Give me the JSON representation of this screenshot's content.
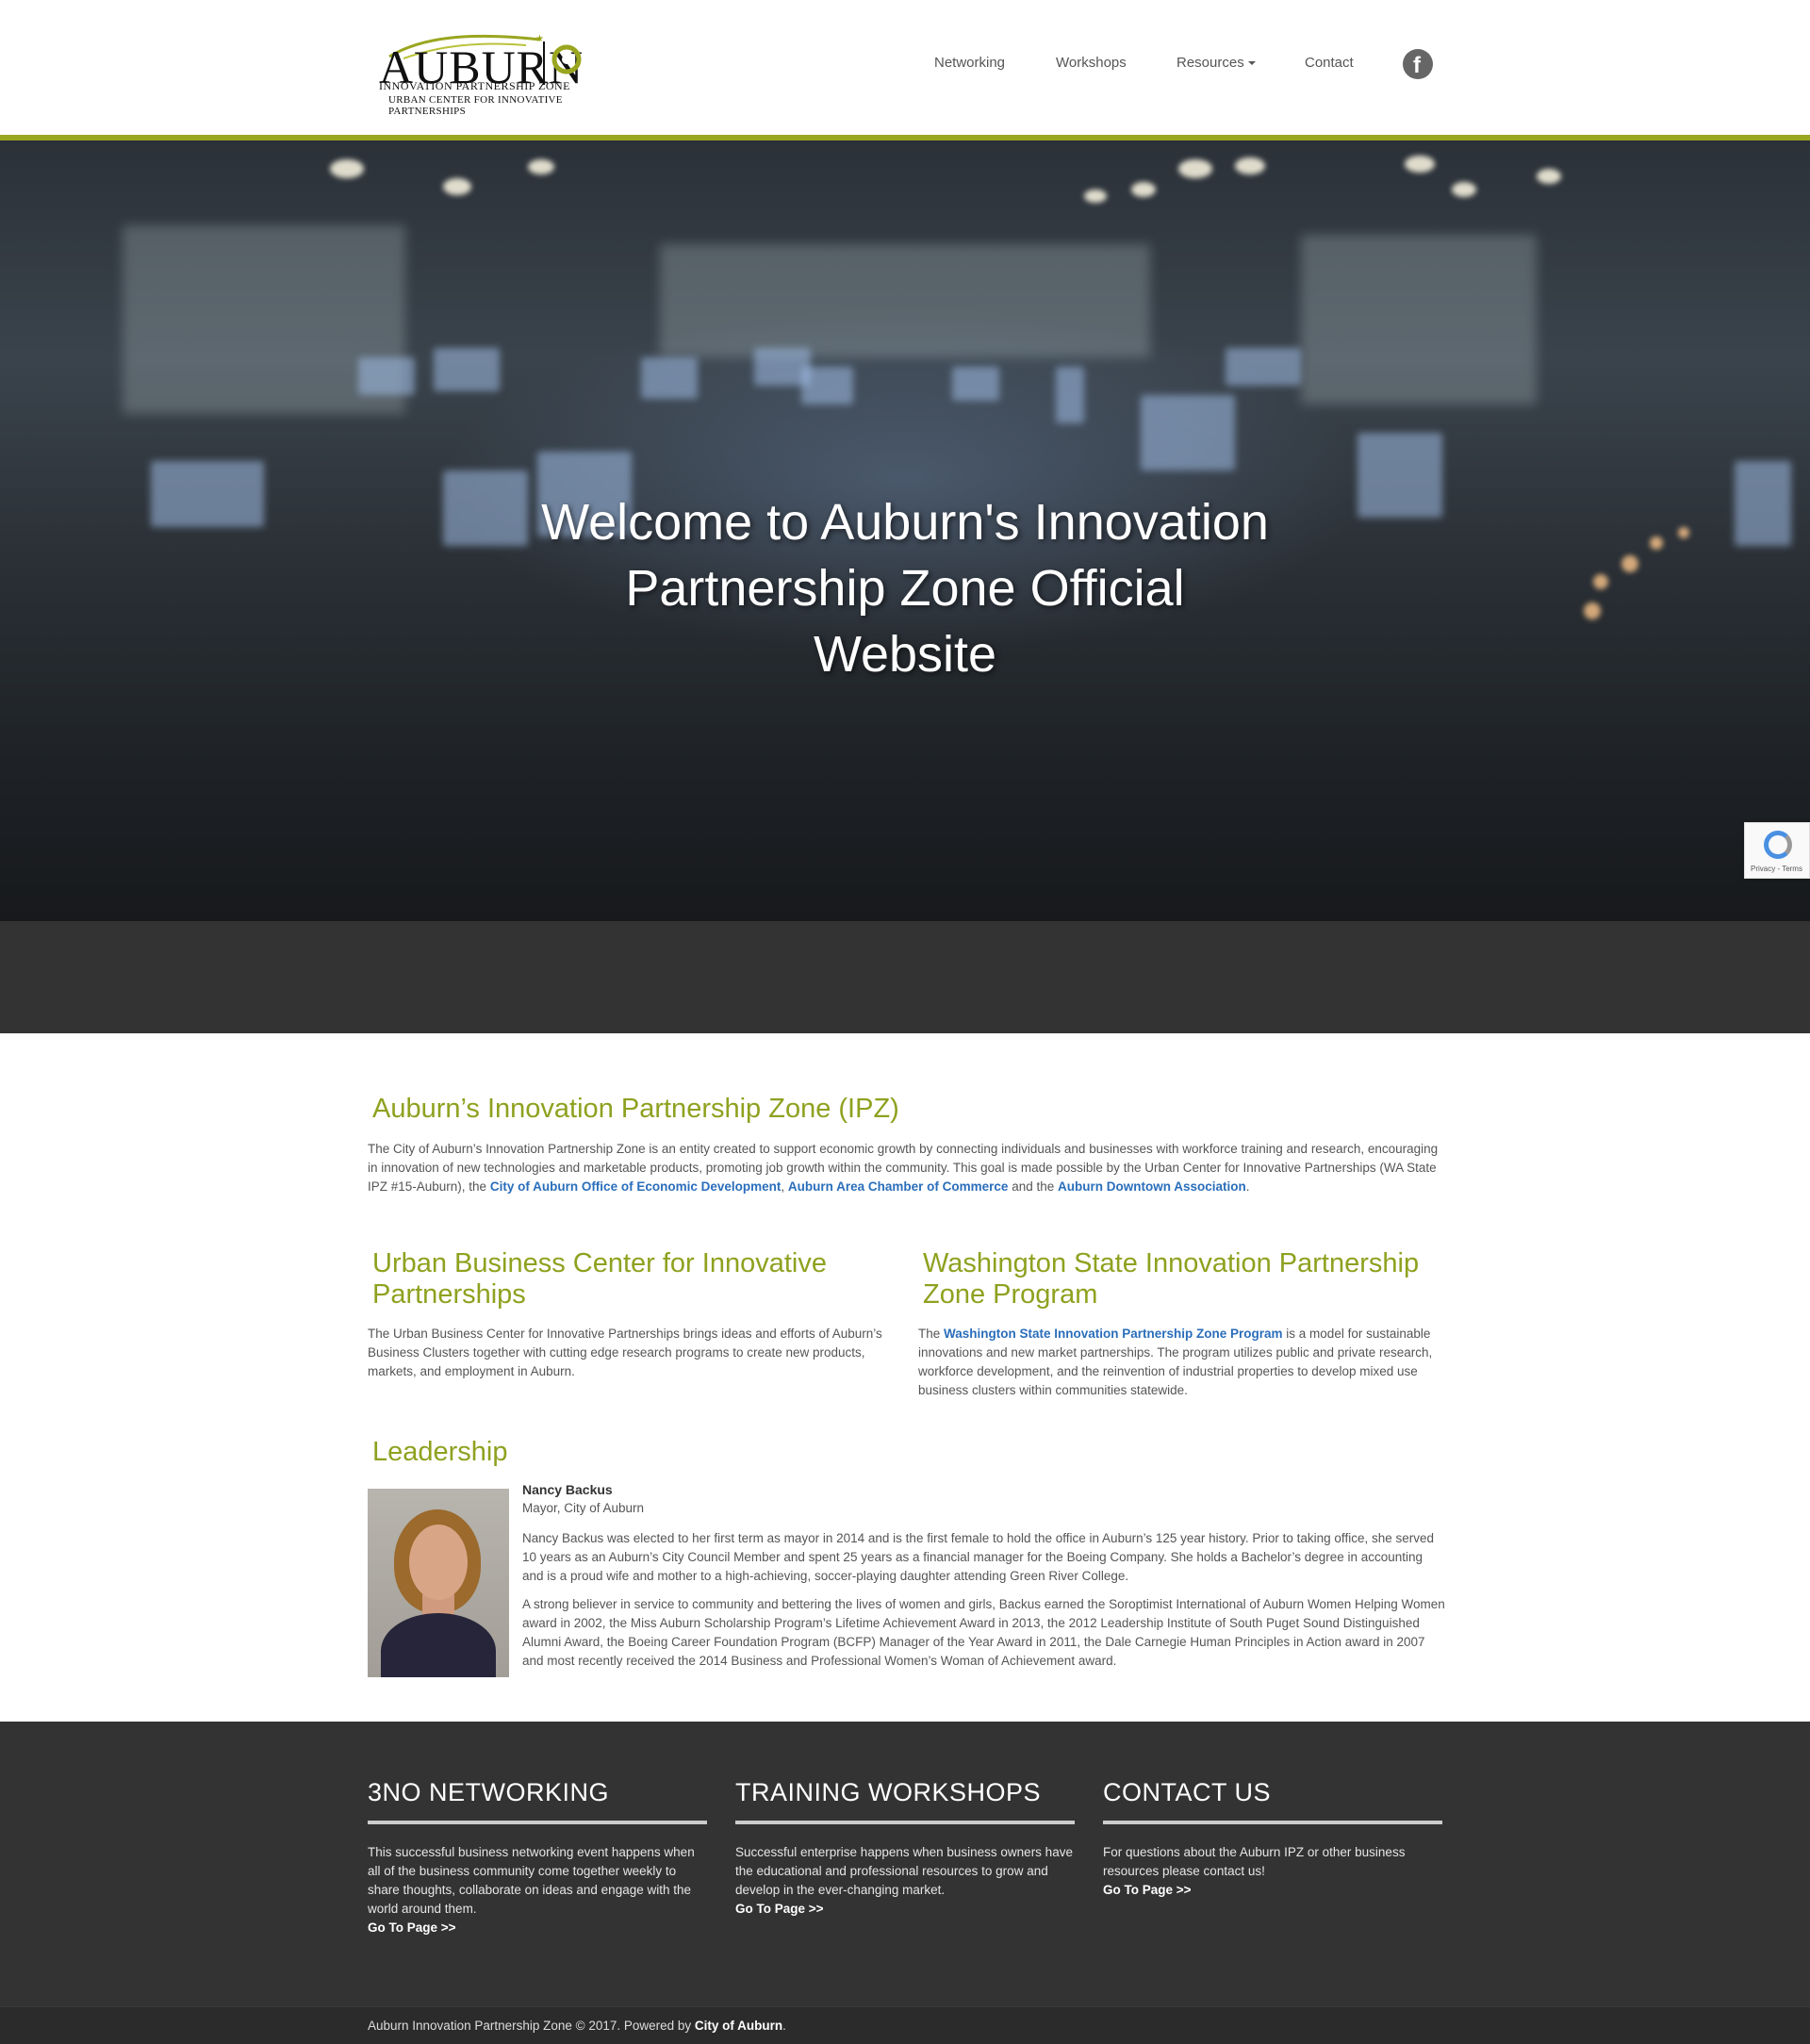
{
  "header": {
    "logo": {
      "word": "AUBURN",
      "line1": "INNOVATION PARTNERSHIP ZONE",
      "line2": "URBAN CENTER FOR INNOVATIVE PARTNERSHIPS"
    },
    "nav": [
      "Networking",
      "Workshops",
      "Resources",
      "Contact"
    ],
    "social_icon": "facebook-icon",
    "accent_color": "#9aa61f"
  },
  "hero": {
    "title": "Welcome to Auburn's Innovation Partnership Zone Official Website"
  },
  "recaptcha": {
    "text": "Privacy - Terms"
  },
  "ipz": {
    "title": "Auburn’s Innovation Partnership Zone (IPZ)",
    "text_before": "The City of Auburn’s Innovation Partnership Zone is an entity created to support economic growth by connecting individuals and businesses with workforce training and research, encouraging in innovation of new technologies and marketable products, promoting job growth within the community. This goal is made possible by the Urban Center for Innovative Partnerships (WA State IPZ #15-Auburn), the ",
    "link1": "City of Auburn Office of Economic Development",
    "sep": ", ",
    "link2": "Auburn Area Chamber of Commerce",
    "and": " and the ",
    "link3": "Auburn Downtown Association",
    "end": "."
  },
  "ubc": {
    "title": "Urban Business Center for Innovative Partnerships",
    "text": "The Urban Business Center for Innovative Partnerships brings ideas and efforts of Auburn’s Business Clusters together with cutting edge research programs to create new products, markets, and employment in Auburn."
  },
  "wsi": {
    "title": "Washington State Innovation Partnership Zone Program",
    "text_before": "The ",
    "link": "Washington State Innovation Partnership Zone Program",
    "text_after": " is a model for sustainable innovations and new market partnerships. The program utilizes public and private research, workforce development, and the reinvention of industrial properties to develop mixed use business clusters within communities statewide."
  },
  "leadership": {
    "title": "Leadership",
    "name": "Nancy Backus",
    "role": "Mayor, City of Auburn",
    "p1": "Nancy Backus was elected to her first term as mayor in 2014 and is the first female to hold the office in Auburn’s 125 year history. Prior to taking office, she served 10 years as an Auburn’s City Council Member and spent 25 years as a financial manager for the Boeing Company. She holds a Bachelor’s degree in accounting and is a proud wife and mother to a high-achieving, soccer-playing daughter attending Green River College.",
    "p2": "A strong believer in service to community and bettering the lives of women and girls, Backus earned the Soroptimist International of Auburn Women Helping Women award in 2002, the Miss Auburn Scholarship Program’s Lifetime Achievement Award in 2013, the 2012 Leadership Institute of South Puget Sound Distinguished Alumni Award, the Boeing Career Foundation Program (BCFP) Manager of the Year Award in 2011, the Dale Carnegie Human Principles in Action award in 2007 and most recently received the 2014 Business and Professional Women’s Woman of Achievement award."
  },
  "footer": {
    "columns": [
      {
        "title": "3NO NETWORKING",
        "text": "This successful business networking event happens when all of the business community come together weekly to share thoughts, collaborate on ideas and engage with the world around them.",
        "link": "Go To Page >>"
      },
      {
        "title": "TRAINING WORKSHOPS",
        "text": "Successful enterprise happens when business owners have the educational and professional resources to grow and develop in the ever-changing market.",
        "link": "Go To Page >>"
      },
      {
        "title": "CONTACT US",
        "text": "For questions about the Auburn IPZ or other business resources please contact us!",
        "link": "Go To Page >>"
      }
    ],
    "copyright_text": "Auburn Innovation Partnership Zone © 2017. Powered by ",
    "copyright_link": "City of Auburn",
    "copyright_end": "."
  }
}
